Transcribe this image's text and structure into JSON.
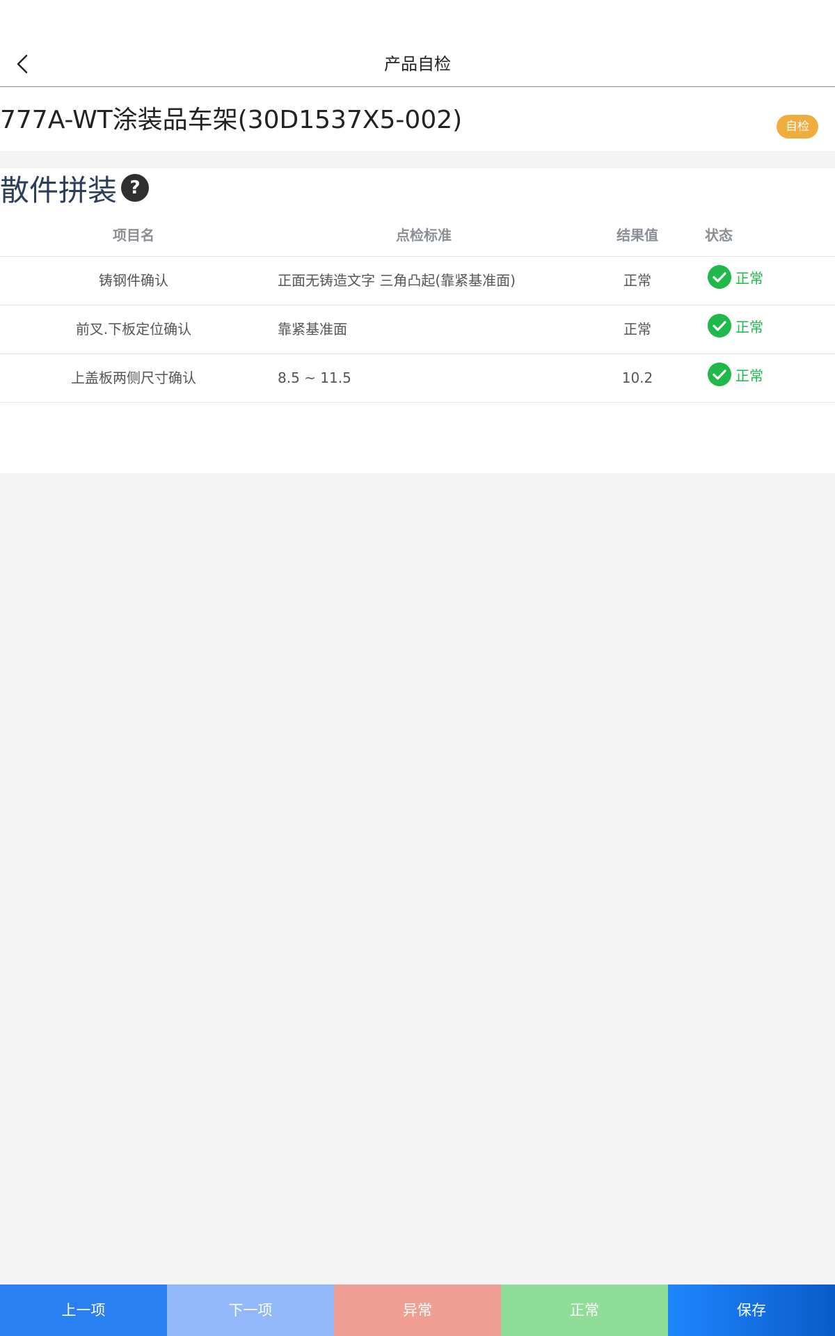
{
  "header": {
    "title": "产品自检"
  },
  "product": {
    "name": "777A-WT涂装品车架(30D1537X5-002)",
    "badge": "自检"
  },
  "section": {
    "title": "散件拼装",
    "help_icon": "?",
    "columns": [
      "项目名",
      "点检标准",
      "结果值",
      "状态"
    ],
    "rows": [
      {
        "name": "铸钢件确认",
        "standard": "正面无铸造文字 三角凸起(靠紧基准面)",
        "result": "正常",
        "status": "正常",
        "status_icon": "check-circle-icon"
      },
      {
        "name": "前叉.下板定位确认",
        "standard": "靠紧基准面",
        "result": "正常",
        "status": "正常",
        "status_icon": "check-circle-icon"
      },
      {
        "name": "上盖板两侧尺寸确认",
        "standard": "8.5 ~ 11.5",
        "result": "10.2",
        "status": "正常",
        "status_icon": "check-circle-icon"
      }
    ]
  },
  "bottom_bar": {
    "buttons": [
      {
        "label": "上一项",
        "color": "#2a7ff3"
      },
      {
        "label": "下一项",
        "color": "#93b8fa"
      },
      {
        "label": "异常",
        "color": "#f09e94"
      },
      {
        "label": "正常",
        "color": "#8fdd98"
      },
      {
        "label": "保存",
        "color": "#1a6ee8"
      }
    ]
  },
  "colors": {
    "accent_green": "#1fb84a",
    "badge_orange": "#f0ad3e",
    "section_title": "#2c3e5c"
  }
}
